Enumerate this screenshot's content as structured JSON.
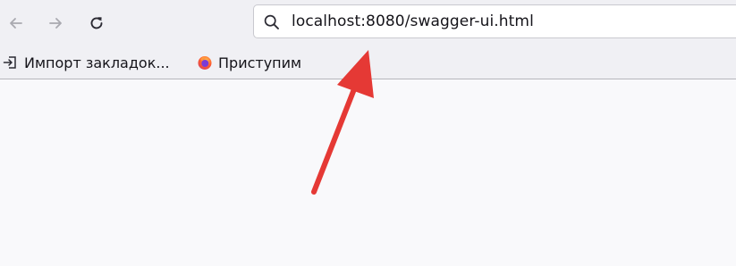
{
  "toolbar": {
    "back_icon": "arrow-left-icon",
    "forward_icon": "arrow-right-icon",
    "reload_icon": "reload-icon",
    "url": "localhost:8080/swagger-ui.html"
  },
  "bookmarks": {
    "items": [
      {
        "label": "Импорт закладок...",
        "icon": "import-icon"
      },
      {
        "label": "Приступим",
        "icon": "firefox-icon"
      }
    ]
  },
  "annotation": {
    "arrow_color": "#e53935"
  }
}
